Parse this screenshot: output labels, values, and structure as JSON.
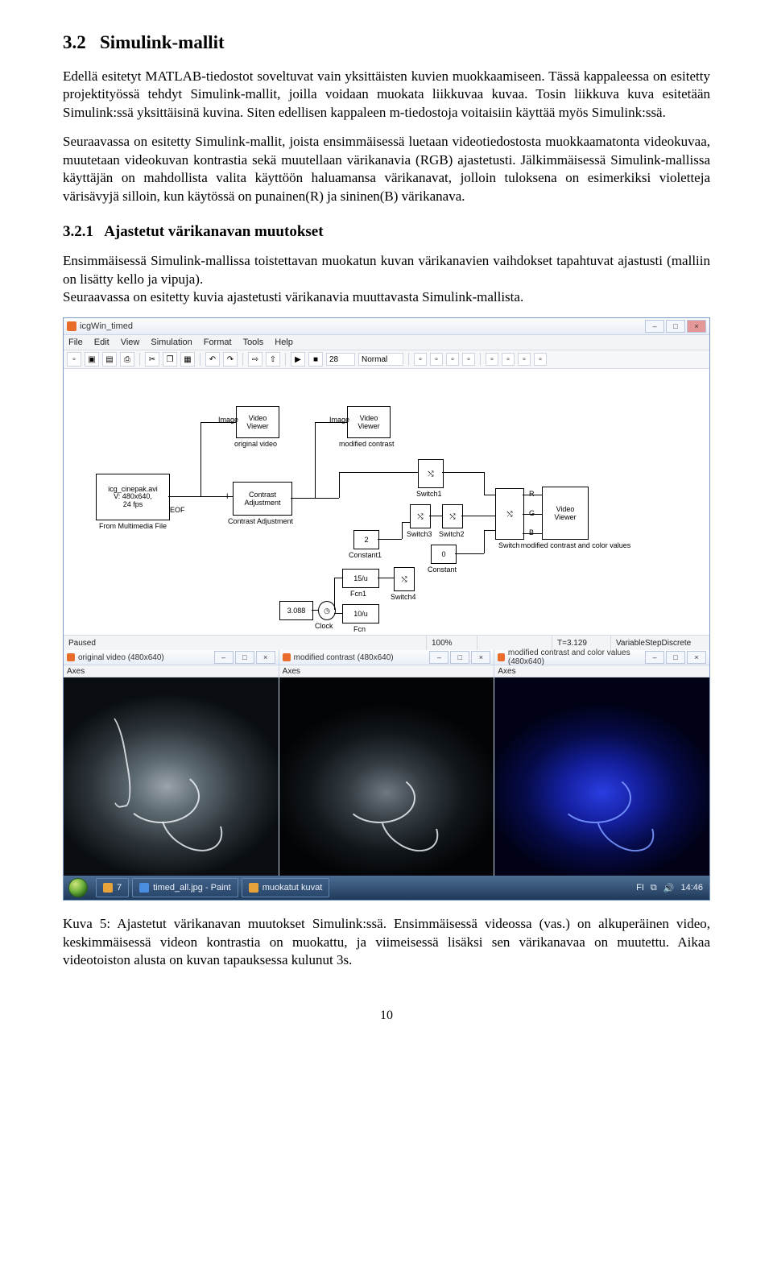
{
  "doc": {
    "section_num": "3.2",
    "section_title": "Simulink-mallit",
    "para1": "Edellä esitetyt MATLAB-tiedostot soveltuvat vain yksittäisten kuvien muokkaamiseen. Tässä kappaleessa on esitetty projektityössä tehdyt Simulink-mallit, joilla voidaan muokata liikkuvaa kuvaa. Tosin liikkuva kuva esitetään Simulink:ssä yksittäisinä kuvina. Siten edellisen kappaleen m-tiedostoja voitaisiin käyttää myös Simulink:ssä.",
    "para2": "Seuraavassa on esitetty Simulink-mallit, joista ensimmäisessä luetaan videotiedostosta muokkaamatonta videokuvaa, muutetaan videokuvan kontrastia sekä muutellaan värikanavia (RGB) ajastetusti. Jälkimmäisessä Simulink-mallissa käyttäjän on mahdollista valita käyttöön haluamansa värikanavat, jolloin tuloksena on esimerkiksi violetteja värisävyjä silloin, kun käytössä on punainen(R) ja sininen(B) värikanava.",
    "subsection_num": "3.2.1",
    "subsection_title": "Ajastetut värikanavan muutokset",
    "para3": "Ensimmäisessä Simulink-mallissa toistettavan muokatun kuvan värikanavien vaihdokset tapahtuvat ajastusti (malliin on lisätty kello ja vipuja).",
    "para4": "Seuraavassa on esitetty kuvia ajastetusti värikanavia muuttavasta Simulink-mallista.",
    "caption": "Kuva 5: Ajastetut värikanavan muutokset Simulink:ssä. Ensimmäisessä videossa (vas.) on alkuperäinen video, keskimmäisessä videon kontrastia on muokattu, ja viimeisessä lisäksi sen värikanavaa on muutettu. Aikaa videotoiston alusta on kuvan tapauksessa kulunut 3s.",
    "pagenum": "10"
  },
  "simwin": {
    "title": "icgWin_timed",
    "menu": [
      "File",
      "Edit",
      "View",
      "Simulation",
      "Format",
      "Tools",
      "Help"
    ],
    "stoptime": "28",
    "mode": "Normal",
    "blocks": {
      "src_lines": [
        "icg_cinepak.avi",
        "V: 480x640,",
        "24 fps"
      ],
      "src_eof": "EOF",
      "src_sub": "From Multimedia File",
      "viewer1_img": "Image",
      "viewer1_lbl": "Video\nViewer",
      "viewer1_sub": "original video",
      "viewer2_img": "Image",
      "viewer2_lbl": "Video\nViewer",
      "viewer2_sub": "modified contrast",
      "viewer3_lbl": "Video\nViewer",
      "viewer3_sub": "modified contrast and color values",
      "contrast_in": "I",
      "contrast_lbl": "Contrast\nAdjustment",
      "contrast_sub": "Contrast Adjustment",
      "sw1": "Switch1",
      "sw2": "Switch2",
      "sw3": "Switch3",
      "sw4": "Switch4",
      "sw": "Switch",
      "const1_val": "2",
      "const1_sub": "Constant1",
      "const_val": "0",
      "const_sub": "Constant",
      "fcn1_expr": "15/u",
      "fcn1_sub": "Fcn1",
      "fcn_expr": "10/u",
      "fcn_sub": "Fcn",
      "clock_val": "3.088",
      "clock_sub": "Clock",
      "r": "R",
      "g": "G",
      "b": "B"
    },
    "status": {
      "left": "Paused",
      "zoom": "100%",
      "time": "T=3.129",
      "solver": "VariableStepDiscrete"
    }
  },
  "viewers": {
    "v1": {
      "title": "original video (480x640)",
      "menu": "Axes"
    },
    "v2": {
      "title": "modified contrast (480x640)",
      "menu": "Axes"
    },
    "v3": {
      "title": "modified contrast and color values (480x640)",
      "menu": "Axes"
    }
  },
  "taskbar": {
    "items": [
      {
        "label": "7"
      },
      {
        "label": "timed_all.jpg - Paint"
      },
      {
        "label": "muokatut kuvat"
      }
    ],
    "lang": "FI",
    "clock": "14:46"
  }
}
